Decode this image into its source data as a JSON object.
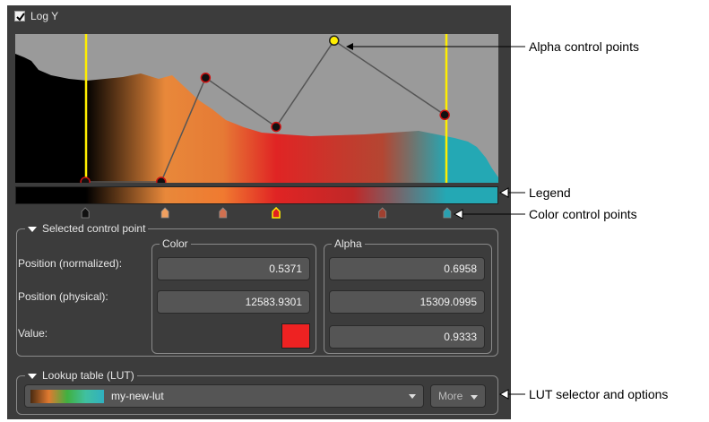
{
  "log_y": {
    "label": "Log Y",
    "checked": true
  },
  "alpha_points": [
    {
      "position": 0.145,
      "alpha": 0.0
    },
    {
      "position": 0.302,
      "alpha": 0.0
    },
    {
      "position": 0.394,
      "alpha": 0.7
    },
    {
      "position": 0.54,
      "alpha": 0.37
    },
    {
      "position": 0.66,
      "alpha": 0.95
    },
    {
      "position": 0.889,
      "alpha": 0.45
    }
  ],
  "color_points": [
    {
      "position": 0.145,
      "color": "#111111"
    },
    {
      "position": 0.31,
      "color": "#f0a060"
    },
    {
      "position": 0.43,
      "color": "#d07050"
    },
    {
      "position": 0.54,
      "color": "#e02020"
    },
    {
      "position": 0.76,
      "color": "#a04030"
    },
    {
      "position": 0.894,
      "color": "#2aa0b0"
    }
  ],
  "selected_control_point": {
    "title": "Selected control point",
    "row_labels": [
      "Position (normalized):",
      "Position (physical):",
      "Value:"
    ],
    "color_group_title": "Color",
    "alpha_group_title": "Alpha",
    "color_position_normalized": "0.5371",
    "color_position_physical": "12583.9301",
    "color_value_swatch": "#ee2222",
    "alpha_position_normalized": "0.6958",
    "alpha_position_physical": "15309.0995",
    "alpha_value": "0.9333"
  },
  "lut": {
    "title": "Lookup table (LUT)",
    "selected_name": "my-new-lut",
    "more_label": "More"
  },
  "annotations": {
    "alpha_control_points": "Alpha control points",
    "legend": "Legend",
    "color_control_points": "Color control points",
    "lut_selector": "LUT selector and options"
  },
  "colors": {
    "panel_bg": "#3c3c3c",
    "plot_bg": "#9a9a9a",
    "threshold_line": "#ffee00"
  }
}
